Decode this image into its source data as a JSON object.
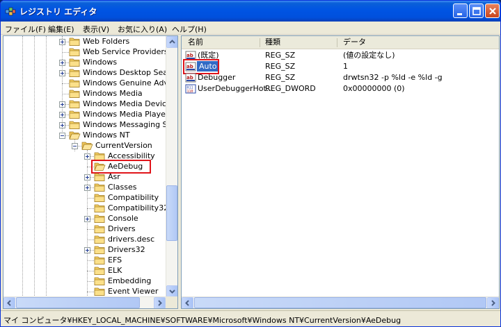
{
  "window": {
    "title": "レジストリ エディタ",
    "colors": {
      "titlebar": "#0054e3",
      "selection": "#316ac5",
      "highlight_box": "#e0141a"
    }
  },
  "menu": [
    {
      "label": "ファイル(F)"
    },
    {
      "label": "編集(E)"
    },
    {
      "label": "表示(V)"
    },
    {
      "label": "お気に入り(A)"
    },
    {
      "label": "ヘルプ(H)"
    }
  ],
  "tree": [
    {
      "label": "Web Folders",
      "expander": "plus"
    },
    {
      "label": "Web Service Providers",
      "expander": "none"
    },
    {
      "label": "Windows",
      "expander": "plus"
    },
    {
      "label": "Windows Desktop Search",
      "expander": "plus"
    },
    {
      "label": "Windows Genuine Advant",
      "expander": "none"
    },
    {
      "label": "Windows Media",
      "expander": "none"
    },
    {
      "label": "Windows Media Device M",
      "expander": "plus"
    },
    {
      "label": "Windows Media Player N",
      "expander": "plus"
    },
    {
      "label": "Windows Messaging Subs",
      "expander": "plus"
    },
    {
      "label": "Windows NT",
      "expander": "minus"
    },
    {
      "label": "CurrentVersion",
      "expander": "minus"
    },
    {
      "label": "Accessibility",
      "expander": "plus"
    },
    {
      "label": "AeDebug",
      "expander": "none",
      "selected": true
    },
    {
      "label": "Asr",
      "expander": "plus"
    },
    {
      "label": "Classes",
      "expander": "plus"
    },
    {
      "label": "Compatibility",
      "expander": "none"
    },
    {
      "label": "Compatibility32",
      "expander": "none"
    },
    {
      "label": "Console",
      "expander": "plus"
    },
    {
      "label": "Drivers",
      "expander": "none"
    },
    {
      "label": "drivers.desc",
      "expander": "none"
    },
    {
      "label": "Drivers32",
      "expander": "plus"
    },
    {
      "label": "EFS",
      "expander": "none"
    },
    {
      "label": "ELK",
      "expander": "none"
    },
    {
      "label": "Embedding",
      "expander": "none"
    },
    {
      "label": "Event Viewer",
      "expander": "none"
    }
  ],
  "list": {
    "headers": {
      "name": "名前",
      "type": "種類",
      "data": "データ"
    },
    "rows": [
      {
        "icon": "string-value-icon",
        "name": "(既定)",
        "type": "REG_SZ",
        "data": "(値の設定なし)"
      },
      {
        "icon": "string-value-icon",
        "name": "Auto",
        "type": "REG_SZ",
        "data": "1",
        "selected": true
      },
      {
        "icon": "string-value-icon",
        "name": "Debugger",
        "type": "REG_SZ",
        "data": "drwtsn32 -p %ld -e %ld -g"
      },
      {
        "icon": "binary-value-icon",
        "name": "UserDebuggerHot...",
        "type": "REG_DWORD",
        "data": "0x00000000 (0)"
      }
    ]
  },
  "status": {
    "path": "マイ コンピュータ¥HKEY_LOCAL_MACHINE¥SOFTWARE¥Microsoft¥Windows NT¥CurrentVersion¥AeDebug"
  }
}
